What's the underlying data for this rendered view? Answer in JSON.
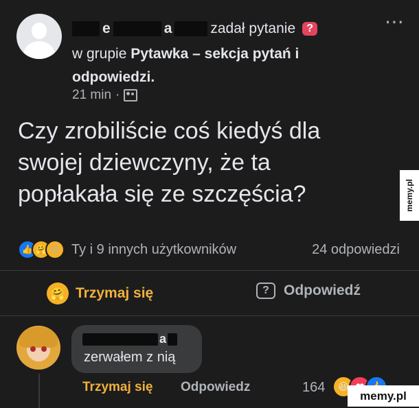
{
  "post": {
    "author_part1": "e",
    "author_part2": "a",
    "action_text": "zadał pytanie",
    "question_badge": "?",
    "in_group_text": "w grupie",
    "group_name": "Pytawka – sekcja pytań i odpowiedzi.",
    "time": "21 min",
    "separator": "·",
    "more_icon": "⋯",
    "question": "Czy zrobiliście coś kiedyś dla swojej dziewczyny, że ta popłakała się ze szczęścia?",
    "reactions_text": "Ty i 9 innych użytkowników",
    "answers_count": "24 odpowiedzi",
    "reaction_icons": [
      "like-icon",
      "care-icon",
      "sad-icon"
    ]
  },
  "actions": {
    "care_label": "Trzymaj się",
    "answer_label": "Odpowiedź"
  },
  "comment": {
    "author_part": "a",
    "text": "zerwałem z nią",
    "care_label": "Trzymaj się",
    "reply_label": "Odpowiedz",
    "reaction_count": "164",
    "reaction_icons": [
      "haha-icon",
      "love-icon",
      "like-icon"
    ]
  },
  "watermarks": {
    "side": "memy.pl",
    "corner": "memy.pl"
  },
  "colors": {
    "background": "#1c1c1d",
    "accent_yellow": "#f0b13c",
    "question_badge": "#e4455e",
    "like_blue": "#1877f2"
  }
}
